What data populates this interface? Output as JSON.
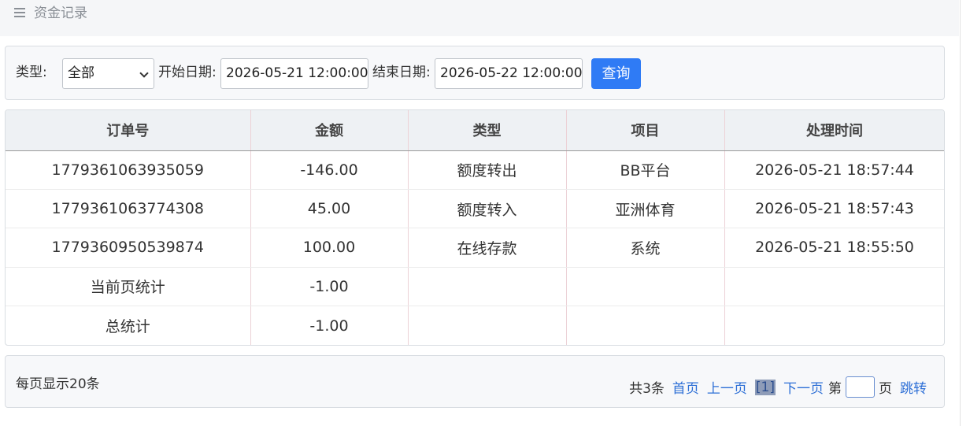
{
  "header": {
    "title": "资金记录",
    "icon": "menu-icon"
  },
  "filter": {
    "type_label": "类型:",
    "type_value": "全部",
    "start_label": "开始日期:",
    "start_value": "2026-05-21 12:00:00",
    "end_label": "结束日期:",
    "end_value": "2026-05-22 12:00:00",
    "query_button": "查询",
    "accent": "#2f7bf5"
  },
  "table": {
    "columns": [
      "订单号",
      "金额",
      "类型",
      "项目",
      "处理时间"
    ],
    "rows": [
      [
        "1779361063935059",
        "-146.00",
        "额度转出",
        "BB平台",
        "2026-05-21 18:57:44"
      ],
      [
        "1779361063774308",
        "45.00",
        "额度转入",
        "亚洲体育",
        "2026-05-21 18:57:43"
      ],
      [
        "1779360950539874",
        "100.00",
        "在线存款",
        "系统",
        "2026-05-21 18:55:50"
      ],
      [
        "当前页统计",
        "-1.00",
        "",
        "",
        ""
      ],
      [
        "总统计",
        "-1.00",
        "",
        "",
        ""
      ]
    ]
  },
  "pager": {
    "per_page": "每页显示20条",
    "total": "共3条",
    "first": "首页",
    "prev": "上一页",
    "current": "[1]",
    "next": "下一页",
    "goto_prefix": "第",
    "goto_suffix": "页",
    "jump": "跳转"
  }
}
